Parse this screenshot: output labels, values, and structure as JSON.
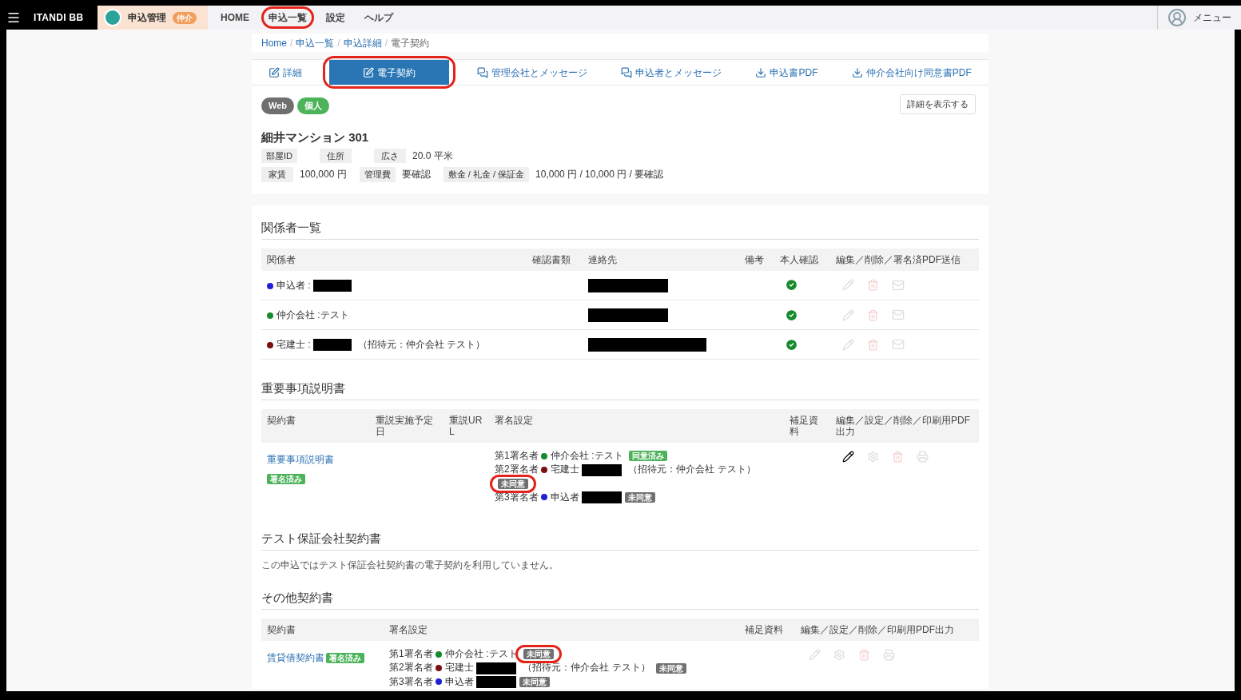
{
  "header": {
    "brand": "ITANDI BB",
    "app": {
      "name": "申込管理",
      "badge": "仲介"
    },
    "nav": [
      {
        "label": "HOME",
        "annotated": false
      },
      {
        "label": "申込一覧",
        "annotated": true
      },
      {
        "label": "設定",
        "annotated": false
      },
      {
        "label": "ヘルプ",
        "annotated": false
      }
    ],
    "user": "メニュー"
  },
  "breadcrumb": [
    {
      "label": "Home",
      "current": false,
      "separator": "/"
    },
    {
      "label": "申込一覧",
      "current": false,
      "separator": "/"
    },
    {
      "label": "申込詳細",
      "current": false,
      "separator": "/"
    },
    {
      "label": "電子契約",
      "current": true
    }
  ],
  "tabs": [
    {
      "label": "詳細",
      "kind": "edit",
      "selected": false,
      "annotated": false
    },
    {
      "label": "電子契約",
      "kind": "edit",
      "selected": true,
      "annotated": true
    },
    {
      "label": "管理会社とメッセージ",
      "kind": "chat",
      "selected": false,
      "annotated": false
    },
    {
      "label": "申込者とメッセージ",
      "kind": "chat",
      "selected": false,
      "annotated": false
    },
    {
      "label": "申込書PDF",
      "kind": "download",
      "selected": false,
      "annotated": false
    },
    {
      "label": "仲介会社向け同意書PDF",
      "kind": "download",
      "selected": false,
      "annotated": false
    }
  ],
  "tags": [
    {
      "label": "Web",
      "color": "#6f6f6f"
    },
    {
      "label": "個人",
      "color": "#4cb35a"
    }
  ],
  "detail_button": "詳細を表示する",
  "property": {
    "title": "細井マンション 301",
    "lines": [
      {
        "fields": [
          {
            "label": "部屋ID"
          },
          {
            "label": "住所"
          },
          {
            "label": "広さ",
            "value": "20.0 平米"
          }
        ]
      },
      {
        "fields": [
          {
            "label": "家賃",
            "value": "100,000 円"
          },
          {
            "label": "管理費",
            "value": "要確認"
          },
          {
            "label": "敷金 / 礼金 / 保証金",
            "value": "10,000 円 / 10,000 円 / 要確認"
          }
        ]
      }
    ]
  },
  "parties": {
    "title": "関係者一覧",
    "columns": [
      "関係者",
      "確認書類",
      "連絡先",
      "備考",
      "本人確認",
      "編集／削除／署名済PDF送信"
    ],
    "rows": [
      {
        "color": "#1f1fd8",
        "label": "申込者 :",
        "name_redacted": true,
        "contact_redacted": true,
        "verified": true
      },
      {
        "color": "#168a2c",
        "label": "仲介会社 :テスト",
        "name_redacted": false,
        "contact_redacted": true,
        "verified": true
      },
      {
        "color": "#7a1010",
        "label": "宅建士 :",
        "name_redacted": true,
        "note": "（招待元：仲介会社 テスト）",
        "contact_redacted": true,
        "verified": true
      }
    ]
  },
  "explanation": {
    "title": "重要事項説明書",
    "columns": [
      "契約書",
      "重説実施予定日",
      "重説URL",
      "署名設定",
      "補足資料",
      "編集／設定／削除／印刷用PDF出力"
    ],
    "rows": [
      {
        "document": "重要事項説明書",
        "document_badge": "署名済み",
        "signers": [
          {
            "order": "第1署名者",
            "color": "#168a2c",
            "label": "仲介会社 :テスト",
            "name_redacted": false,
            "status": "同意済み",
            "agreed": true,
            "annotated": false
          },
          {
            "order": "第2署名者",
            "color": "#7a1010",
            "label": "宅建士",
            "name_redacted": true,
            "note": "（招待元：仲介会社 テスト）",
            "status": "未同意",
            "agreed": false,
            "annotated": true
          },
          {
            "order": "第3署名者",
            "color": "#1f1fd8",
            "label": "申込者",
            "name_redacted": true,
            "status": "未同意",
            "agreed": false,
            "annotated": false
          }
        ],
        "edit_enabled": true
      }
    ]
  },
  "guarantee": {
    "title": "テスト保証会社契約書",
    "message": "この申込ではテスト保証会社契約書の電子契約を利用していません。"
  },
  "others": {
    "title": "その他契約書",
    "columns": [
      "契約書",
      "署名設定",
      "補足資料",
      "編集／設定／削除／印刷用PDF出力"
    ],
    "rows": [
      {
        "document": "賃貸借契約書",
        "document_badge": "署名済み",
        "signers": [
          {
            "order": "第1署名者",
            "color": "#168a2c",
            "label": "仲介会社 :テスト",
            "name_redacted": false,
            "status": "未同意",
            "agreed": false,
            "annotated": true
          },
          {
            "order": "第2署名者",
            "color": "#7a1010",
            "label": "宅建士",
            "name_redacted": true,
            "note": "（招待元：仲介会社 テスト）",
            "status": "未同意",
            "agreed": false,
            "annotated": false
          },
          {
            "order": "第3署名者",
            "color": "#1f1fd8",
            "label": "申込者",
            "name_redacted": true,
            "status": "未同意",
            "agreed": false,
            "annotated": false
          }
        ],
        "edit_enabled": false
      }
    ]
  }
}
